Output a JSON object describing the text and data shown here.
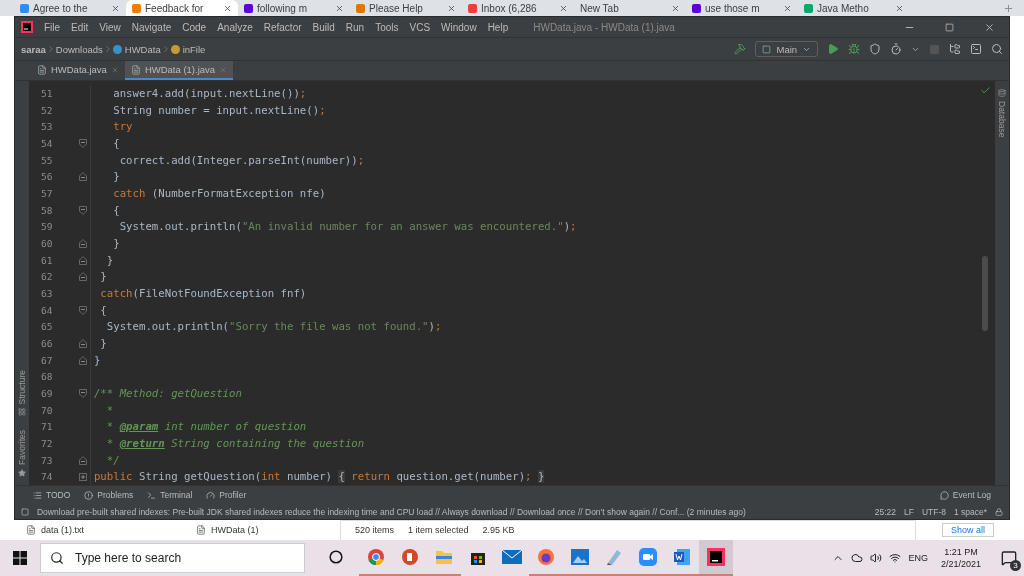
{
  "browser": {
    "tabs": [
      {
        "label": "Agree to the",
        "color": "#2d8cff",
        "selected": false
      },
      {
        "label": "Feedback for",
        "color": "#f57c00",
        "selected": true
      },
      {
        "label": "following m",
        "color": "#6001d2",
        "selected": false
      },
      {
        "label": "Please Help",
        "color": "#eb7100",
        "selected": false
      },
      {
        "label": "Inbox (6,286",
        "color": "#ea4335",
        "selected": false
      },
      {
        "label": "New Tab",
        "selected": false
      },
      {
        "label": "use those m",
        "color": "#6001d2",
        "selected": false
      },
      {
        "label": "Java Metho",
        "color": "#04aa6d",
        "selected": false
      }
    ]
  },
  "ide": {
    "menu": [
      "File",
      "Edit",
      "View",
      "Navigate",
      "Code",
      "Analyze",
      "Refactor",
      "Build",
      "Run",
      "Tools",
      "VCS",
      "Window",
      "Help"
    ],
    "title": "HWData.java - HWData (1).java",
    "breadcrumbs": [
      {
        "label": "saraa",
        "kind": "root"
      },
      {
        "label": "Downloads",
        "kind": "folder"
      },
      {
        "label": "HWData",
        "kind": "class"
      },
      {
        "label": "inFile",
        "kind": "field"
      }
    ],
    "run_config": "Main",
    "editor_tabs": [
      {
        "label": "HWData.java",
        "selected": false
      },
      {
        "label": "HWData (1).java",
        "selected": true
      }
    ],
    "code_lines": [
      {
        "number": "51",
        "kind": "plain",
        "segments": [
          {
            "kind": "plain",
            "text": "   answer4.add(input.nextLine())"
          },
          {
            "kind": "keyword",
            "text": ";"
          }
        ]
      },
      {
        "number": "52",
        "kind": "plain",
        "segments": [
          {
            "kind": "plain",
            "text": "   String number = input.nextLine()"
          },
          {
            "kind": "keyword",
            "text": ";"
          }
        ]
      },
      {
        "number": "53",
        "kind": "plain",
        "segments": [
          {
            "kind": "keyword",
            "text": "   try"
          }
        ]
      },
      {
        "number": "54",
        "kind": "fold-start",
        "segments": [
          {
            "kind": "plain",
            "text": "   {"
          }
        ]
      },
      {
        "number": "55",
        "kind": "plain",
        "segments": [
          {
            "kind": "plain",
            "text": "    correct.add(Integer.parseInt(number))"
          },
          {
            "kind": "keyword",
            "text": ";"
          }
        ]
      },
      {
        "number": "56",
        "kind": "fold-end",
        "segments": [
          {
            "kind": "plain",
            "text": "   }"
          }
        ]
      },
      {
        "number": "57",
        "kind": "plain",
        "segments": [
          {
            "kind": "keyword",
            "text": "   catch"
          },
          {
            "kind": "plain",
            "text": " (NumberFormatException nfe)"
          }
        ]
      },
      {
        "number": "58",
        "kind": "fold-start",
        "segments": [
          {
            "kind": "plain",
            "text": "   {"
          }
        ]
      },
      {
        "number": "59",
        "kind": "plain",
        "segments": [
          {
            "kind": "plain",
            "text": "    System.out.println("
          },
          {
            "kind": "string",
            "text": "\"An invalid number for an answer was encountered.\""
          },
          {
            "kind": "plain",
            "text": ")"
          },
          {
            "kind": "keyword",
            "text": ";"
          }
        ]
      },
      {
        "number": "60",
        "kind": "fold-end",
        "segments": [
          {
            "kind": "plain",
            "text": "   }"
          }
        ]
      },
      {
        "number": "61",
        "kind": "fold-end",
        "segments": [
          {
            "kind": "plain",
            "text": "  }"
          }
        ]
      },
      {
        "number": "62",
        "kind": "fold-end",
        "segments": [
          {
            "kind": "plain",
            "text": " }"
          }
        ]
      },
      {
        "number": "63",
        "kind": "plain",
        "segments": [
          {
            "kind": "keyword",
            "text": " catch"
          },
          {
            "kind": "plain",
            "text": "(FileNotFoundException fnf)"
          }
        ]
      },
      {
        "number": "64",
        "kind": "fold-start",
        "segments": [
          {
            "kind": "plain",
            "text": " {"
          }
        ]
      },
      {
        "number": "65",
        "kind": "plain",
        "segments": [
          {
            "kind": "plain",
            "text": "  System.out.println("
          },
          {
            "kind": "string",
            "text": "\"Sorry the file was not found.\""
          },
          {
            "kind": "plain",
            "text": ")"
          },
          {
            "kind": "keyword",
            "text": ";"
          }
        ]
      },
      {
        "number": "66",
        "kind": "fold-end",
        "segments": [
          {
            "kind": "plain",
            "text": " }"
          }
        ]
      },
      {
        "number": "67",
        "kind": "fold-end",
        "segments": [
          {
            "kind": "plain",
            "text": "}"
          }
        ]
      },
      {
        "number": "68",
        "kind": "plain"
      },
      {
        "number": "69",
        "kind": "fold-start",
        "segments": [
          {
            "kind": "comment",
            "text": "/** Method: getQuestion"
          }
        ]
      },
      {
        "number": "70",
        "kind": "plain",
        "segments": [
          {
            "kind": "comment",
            "text": "  *"
          }
        ]
      },
      {
        "number": "71",
        "kind": "plain",
        "segments": [
          {
            "kind": "comment",
            "text": "  * "
          },
          {
            "kind": "doctag",
            "text": "@param"
          },
          {
            "kind": "comment",
            "text": " int number of question"
          }
        ]
      },
      {
        "number": "72",
        "kind": "plain",
        "segments": [
          {
            "kind": "comment",
            "text": "  * "
          },
          {
            "kind": "doctag",
            "text": "@return"
          },
          {
            "kind": "comment",
            "text": " String containing the question"
          }
        ]
      },
      {
        "number": "73",
        "kind": "fold-end",
        "segments": [
          {
            "kind": "comment",
            "text": "  */"
          }
        ]
      },
      {
        "number": "74",
        "kind": "fold-collapsed",
        "segments": [
          {
            "kind": "keyword",
            "text": "public"
          },
          {
            "kind": "plain",
            "text": " String getQuestion("
          },
          {
            "kind": "keyword",
            "text": "int"
          },
          {
            "kind": "plain",
            "text": " number) "
          },
          {
            "kind": "folded",
            "text": "{"
          },
          {
            "kind": "keyword",
            "text": " return"
          },
          {
            "kind": "plain",
            "text": " question.get(number)"
          },
          {
            "kind": "keyword",
            "text": "; "
          },
          {
            "kind": "folded",
            "text": "}"
          }
        ]
      }
    ],
    "left_tools": [
      "Structure",
      "Favorites"
    ],
    "right_tools": [
      "Database"
    ],
    "tool_windows": [
      "TODO",
      "Problems",
      "Terminal",
      "Profiler"
    ],
    "event_log": "Event Log",
    "status": {
      "message": "Download pre-built shared indexes: Pre-built JDK shared indexes reduce the indexing time and CPU load // Always download // Download once // Don't show again // Conf... (2 minutes ago)",
      "items": [
        "25:22",
        "LF",
        "UTF-8",
        "1 space*"
      ]
    }
  },
  "downloads": [
    "data (1).txt",
    "HWData (1)"
  ],
  "explorer": {
    "count": "520 items",
    "selection": "1 item selected",
    "size": "2.95 KB"
  },
  "show_all": "Show all",
  "taskbar": {
    "search_placeholder": "Type here to search",
    "apps": [
      {
        "kind": "chrome",
        "running": true,
        "selected": false
      },
      {
        "kind": "powerpoint",
        "running": true,
        "selected": false
      },
      {
        "kind": "folder",
        "running": true,
        "selected": false
      },
      {
        "kind": "store",
        "running": false,
        "selected": false
      },
      {
        "kind": "mail",
        "running": false,
        "selected": false
      },
      {
        "kind": "firefox",
        "running": true,
        "selected": false
      },
      {
        "kind": "photos",
        "running": true,
        "selected": false
      },
      {
        "kind": "notepad",
        "running": true,
        "selected": false
      },
      {
        "kind": "zoom",
        "running": true,
        "selected": false
      },
      {
        "kind": "word",
        "running": true,
        "selected": false
      },
      {
        "kind": "intellij",
        "running": true,
        "selected": true
      }
    ],
    "language": "ENG",
    "time": "1:21 PM",
    "date": "2/21/2021",
    "notifications": "3"
  }
}
